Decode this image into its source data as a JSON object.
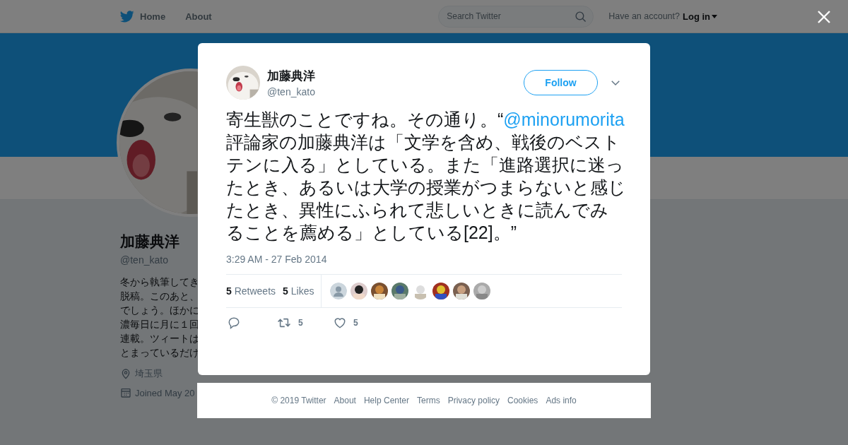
{
  "header": {
    "nav": [
      "Home",
      "About"
    ],
    "search": {
      "placeholder": "Search Twitter"
    },
    "account_prompt": "Have an account?",
    "login": "Log in"
  },
  "profile": {
    "name": "加藤典洋",
    "handle": "@ten_kato",
    "bio_lines": [
      "冬から執筆してき",
      "脱稿。このあと、",
      "でしょう。ほかに",
      "濃毎日に月に１回",
      "連載。ツィートは",
      "とまっているだけ"
    ],
    "location": "埼玉県",
    "joined": "Joined May 20"
  },
  "tweet": {
    "name": "加藤典洋",
    "handle": "@ten_kato",
    "follow": "Follow",
    "text_parts": [
      {
        "kind": "text",
        "text": "寄生獣のことですね。その通り。“"
      },
      {
        "kind": "mention",
        "text": "@minorumorita"
      },
      {
        "kind": "text",
        "text": " 評論家の加藤典洋は「文学を含め、戦後のベストテンに入る」としている。また「進路選択に迷ったとき、あるいは大学の授業がつまらないと感じたとき、異性にふられて悲しいときに読んでみることを薦める」としている[22]。”"
      }
    ],
    "time": "3:29 AM - 27 Feb 2014",
    "stats": [
      {
        "count": "5",
        "label": "Retweets"
      },
      {
        "count": "5",
        "label": "Likes"
      }
    ],
    "liker_avatars": [
      {
        "kind": "default"
      },
      {
        "kind": "picture"
      },
      {
        "kind": "picture"
      },
      {
        "kind": "picture"
      },
      {
        "kind": "picture"
      },
      {
        "kind": "picture"
      },
      {
        "kind": "picture"
      },
      {
        "kind": "picture"
      }
    ],
    "actions": [
      {
        "kind": "reply"
      },
      {
        "kind": "retweet",
        "count": "5"
      },
      {
        "kind": "like",
        "count": "5"
      }
    ]
  },
  "footer": {
    "links": [
      "© 2019 Twitter",
      "About",
      "Help Center",
      "Terms",
      "Privacy policy",
      "Cookies",
      "Ads info"
    ]
  }
}
